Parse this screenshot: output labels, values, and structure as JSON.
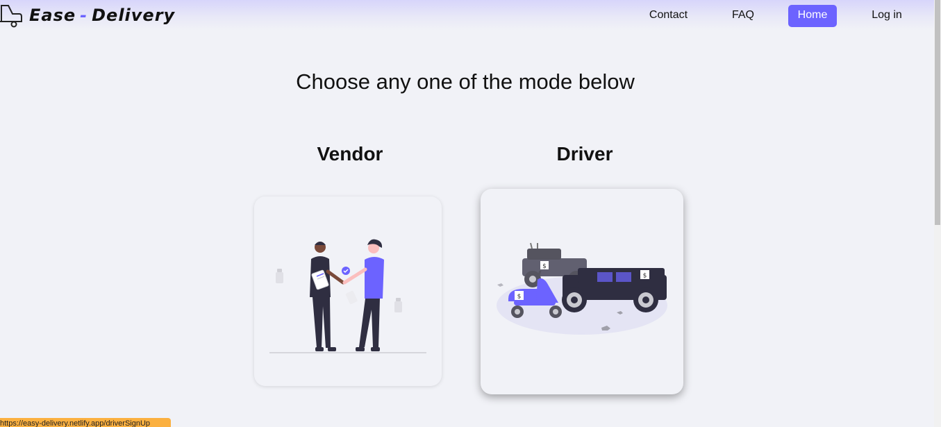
{
  "header": {
    "brand_name_part1": "Ease",
    "brand_dash": "-",
    "brand_name_part2": "Delivery",
    "brand_icon": "delivery-truck-icon",
    "nav": {
      "contact": "Contact",
      "faq": "FAQ",
      "home": "Home",
      "login": "Log in"
    }
  },
  "main": {
    "heading": "Choose any one of the mode below",
    "cards": [
      {
        "title": "Vendor",
        "illustration": "handshake-illustration"
      },
      {
        "title": "Driver",
        "illustration": "vehicles-illustration"
      }
    ]
  },
  "status_bar": {
    "url": "https://easy-delivery.netlify.app/driverSignUp"
  },
  "colors": {
    "accent": "#6c63ff",
    "background": "#f1f2f7",
    "status_tooltip": "#fbb040"
  }
}
